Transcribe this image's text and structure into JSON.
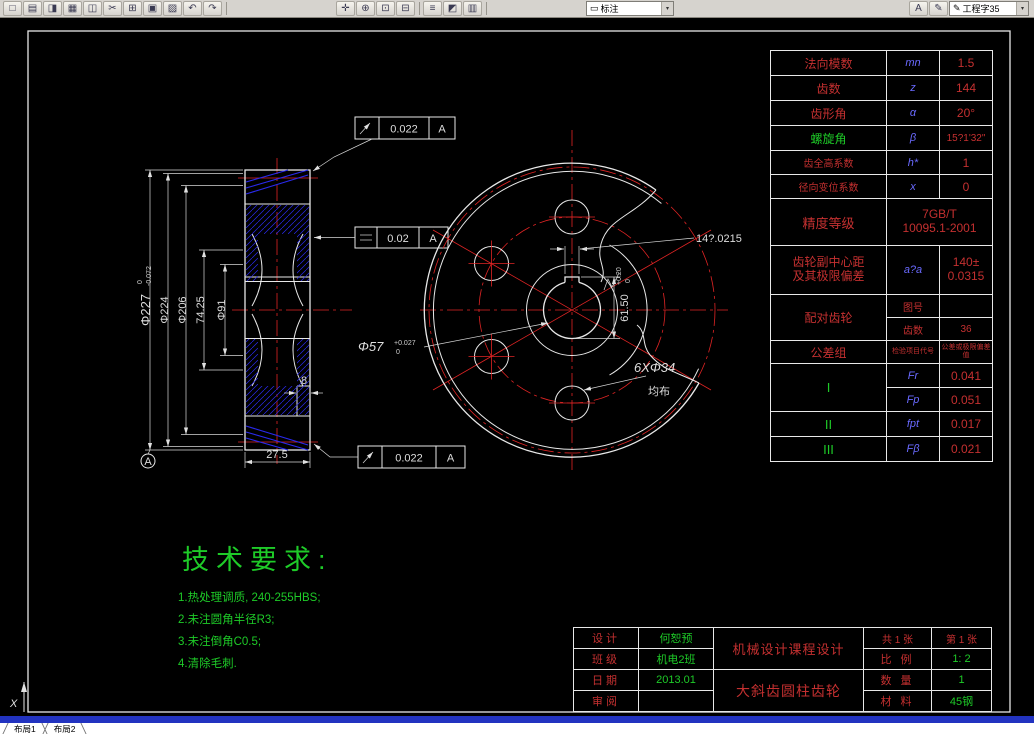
{
  "toolbar": {
    "dim_style": "标注",
    "text_style": "工程字35"
  },
  "icons": {
    "new": "□",
    "open": "▤",
    "save": "◨",
    "plot": "▦",
    "preview": "◫",
    "cut": "✂",
    "copy": "⊞",
    "paste": "▣",
    "match": "▨",
    "undo": "↶",
    "redo": "↷",
    "pan": "✛",
    "zoom_rt": "⊕",
    "zoom_win": "⊡",
    "zoom_prev": "⊟",
    "layers": "≡",
    "color": "◩",
    "linetype": "▥",
    "text_tool": "A",
    "style_tool": "✎",
    "dd_icon": "▭",
    "arrow": "▾",
    "pencil": "✎"
  },
  "statusbar": {
    "tab1": "布局1",
    "tab2": "布局2"
  },
  "ucs": {
    "x_label": "X"
  },
  "gear_table": {
    "r1_label": "法向模数",
    "r1_sym": "mn",
    "r1_val": "1.5",
    "r2_label": "齿数",
    "r2_sym": "z",
    "r2_val": "144",
    "r3_label": "齿形角",
    "r3_sym": "α",
    "r3_val": "20°",
    "r4_label": "螺旋角",
    "r4_sym": "β",
    "r4_val": "15?1'32\"",
    "r5_label": "齿全高系数",
    "r5_sym": "h*",
    "r5_val": "1",
    "r6_label": "径向变位系数",
    "r6_sym": "x",
    "r6_val": "0",
    "r7_label": "精度等级",
    "r7_val1": "7GB/T",
    "r7_val2": "10095.1-2001",
    "r8_label1": "齿轮副中心距",
    "r8_label2": "及其极限偏差",
    "r8_sym": "a?a",
    "r8_val1": "140±",
    "r8_val2": "0.0315",
    "r9_label": "配对齿轮",
    "r9a_label": "图号",
    "r9a_val": "",
    "r9b_label": "齿数",
    "r9b_val": "36",
    "r10_label": "公差组",
    "r10_col2": "检验项目代号",
    "r10_col3": "公差或极限偏差值",
    "g1": "I",
    "g1_sym1": "Fr",
    "g1_val1": "0.041",
    "g1_sym2": "Fp",
    "g1_val2": "0.051",
    "g2": "II",
    "g2_sym": "fpt",
    "g2_val": "0.017",
    "g3": "III",
    "g3_sym": "Fβ",
    "g3_val": "0.021"
  },
  "title_block": {
    "designer_label": "设计",
    "designer": "何恕预",
    "class_label": "班级",
    "class_value": "机电2班",
    "date_label": "日期",
    "date_value": "2013.01",
    "review_label": "审阅",
    "review_value": "",
    "course": "机械设计课程设计",
    "part_name": "大斜齿圆柱齿轮",
    "sheets_total": "共 1 张",
    "sheet_no": "第 1 张",
    "scale_label": "比 例",
    "scale_value": "1: 2",
    "qty_label": "数 量",
    "qty_value": "1",
    "material_label": "材 料",
    "material_value": "45钢"
  },
  "tech_req": {
    "title": "技术要求:",
    "item1": "1.热处理调质, 240-255HBS;",
    "item2": "2.未注圆角半径R3;",
    "item3": "3.未注倒角C0.5;",
    "item4": "4.清除毛刺."
  },
  "dims": {
    "od": "Φ227",
    "od_tol_u": "0",
    "od_tol_l": "-0.072",
    "d224": "Φ224",
    "d206": "Φ206",
    "d7425": "74.25",
    "d91": "Φ91",
    "w8": "8",
    "w275": "27.5",
    "datum": "A",
    "fcf1_val": "0.022",
    "fcf1_ref": "A",
    "fcf2_val": "0.02",
    "fcf2_ref": "A",
    "fcf3_val": "0.022",
    "fcf3_ref": "A",
    "bore": "Φ57",
    "bore_tol_u": "+0.027",
    "bore_tol_l": "0",
    "holes": "6XΦ34",
    "holes_note": "均布",
    "key_w": "14?.0215",
    "key_d": "61.50",
    "key_d_tol_u": "+0.20",
    "key_d_tol_l": "0"
  }
}
